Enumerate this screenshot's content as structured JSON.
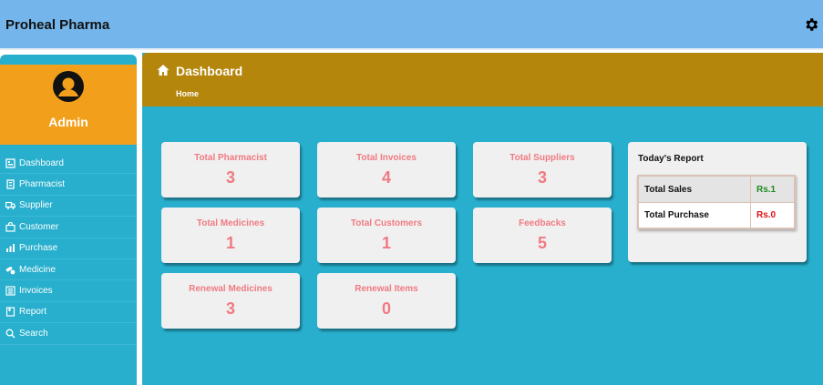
{
  "app": {
    "brand": "Proheal Pharma"
  },
  "sidebar": {
    "profile_name": "Admin",
    "items": [
      {
        "label": "Dashboard",
        "icon": "dashboard-icon"
      },
      {
        "label": "Pharmacist",
        "icon": "pharmacist-icon"
      },
      {
        "label": "Supplier",
        "icon": "truck-icon"
      },
      {
        "label": "Customer",
        "icon": "bag-icon"
      },
      {
        "label": "Purchase",
        "icon": "bar-chart-icon"
      },
      {
        "label": "Medicine",
        "icon": "pills-icon"
      },
      {
        "label": "Invoices",
        "icon": "list-icon"
      },
      {
        "label": "Report",
        "icon": "book-icon"
      },
      {
        "label": "Search",
        "icon": "search-icon"
      }
    ]
  },
  "header": {
    "title": "Dashboard",
    "breadcrumb": "Home"
  },
  "cards": [
    {
      "label": "Total Pharmacist",
      "value": "3"
    },
    {
      "label": "Total Invoices",
      "value": "4"
    },
    {
      "label": "Total Suppliers",
      "value": "3"
    },
    {
      "label": "Total Medicines",
      "value": "1"
    },
    {
      "label": "Total Customers",
      "value": "1"
    },
    {
      "label": "Feedbacks",
      "value": "5"
    },
    {
      "label": "Renewal Medicines",
      "value": "3"
    },
    {
      "label": "Renewal Items",
      "value": "0"
    }
  ],
  "report": {
    "title": "Today's Report",
    "rows": [
      {
        "label": "Total Sales",
        "value": "Rs.1",
        "color": "#1f8a1f"
      },
      {
        "label": "Total Purchase",
        "value": "Rs.0",
        "color": "#e01010"
      }
    ]
  },
  "colors": {
    "topbar": "#74b6ec",
    "sidebar": "#27afcd",
    "profile": "#f2a01c",
    "header": "#b5860c",
    "card_text": "#f07a82"
  }
}
